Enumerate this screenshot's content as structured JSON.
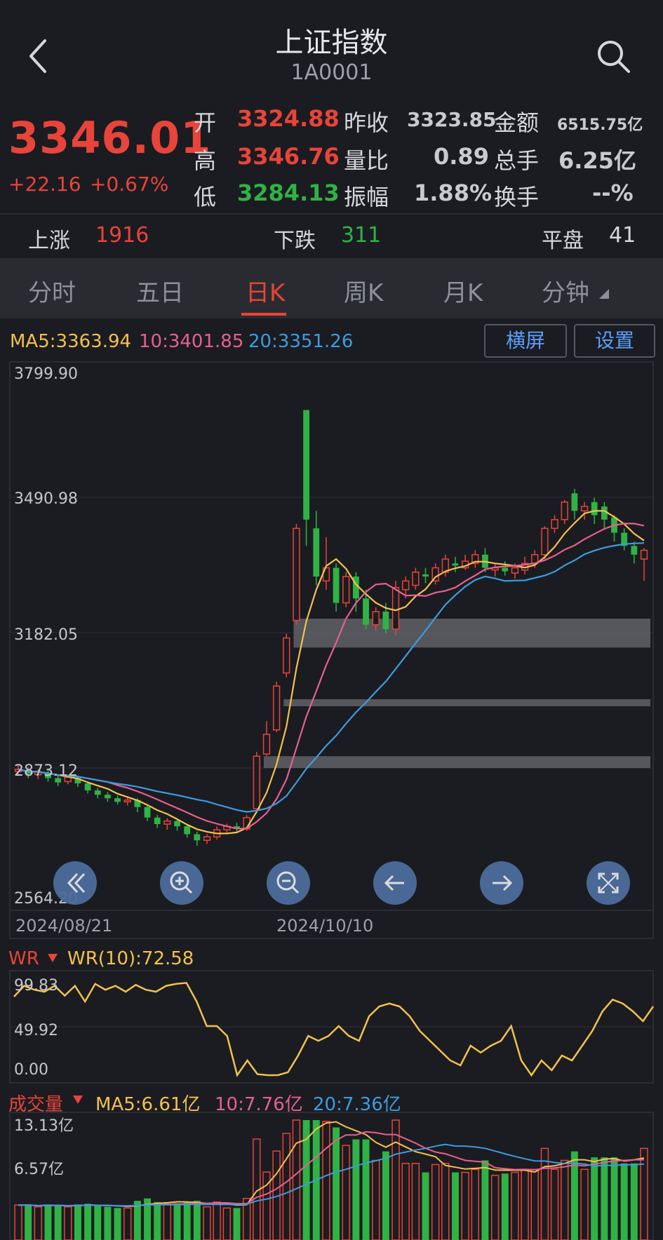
{
  "header": {
    "title": "上证指数",
    "code": "1A0001"
  },
  "quote": {
    "price": "3346.01",
    "change": "+22.16",
    "change_pct": "+0.67%",
    "open_label": "开",
    "open": "3324.88",
    "prev_close_label": "昨收",
    "prev_close": "3323.85",
    "amount_label": "金额",
    "amount": "6515.75亿",
    "high_label": "高",
    "high": "3346.76",
    "vol_ratio_label": "量比",
    "vol_ratio": "0.89",
    "total_vol_label": "总手",
    "total_vol": "6.25亿",
    "low_label": "低",
    "low": "3284.13",
    "amplitude_label": "振幅",
    "amplitude": "1.88%",
    "turnover_label": "换手",
    "turnover": "--%"
  },
  "breadth": {
    "up_label": "上涨",
    "up": "1916",
    "down_label": "下跌",
    "down": "311",
    "flat_label": "平盘",
    "flat": "41"
  },
  "tabs": [
    "分时",
    "五日",
    "日K",
    "周K",
    "月K",
    "分钟"
  ],
  "active_tab": "日K",
  "ma": {
    "ma5": "MA5:3363.94",
    "ma10": "10:3401.85",
    "ma20": "20:3351.26"
  },
  "buttons": {
    "landscape": "横屏",
    "settings": "设置"
  },
  "colors": {
    "red": "#e8443a",
    "green": "#2fb344",
    "ma5": "#f2c14e",
    "ma10": "#e6608f",
    "ma20": "#3d9be0",
    "wr": "#f2c14e"
  },
  "kline_axis": {
    "y_ticks": [
      "3799.90",
      "3490.98",
      "3182.05",
      "2873.12",
      "2564.20"
    ],
    "dates": [
      "2024/08/21",
      "2024/10/10"
    ]
  },
  "nav_icons": [
    "double-left-icon",
    "zoom-in-icon",
    "zoom-out-icon",
    "arrow-left-icon",
    "arrow-right-icon",
    "fullscreen-icon"
  ],
  "wr": {
    "label": "WR",
    "value": "WR(10):72.58",
    "ticks": [
      "99.83",
      "49.92",
      "0.00"
    ]
  },
  "volume": {
    "label": "成交量",
    "ma5": "MA5:6.61亿",
    "ma10": "10:7.76亿",
    "ma20": "20:7.36亿",
    "ticks": [
      "13.13亿",
      "6.57亿"
    ]
  },
  "chart_data": {
    "type": "candlestick",
    "ylim": [
      2564.2,
      3799.9
    ],
    "candles": [
      [
        2865,
        2870,
        2880,
        2855
      ],
      [
        2868,
        2860,
        2875,
        2850
      ],
      [
        2858,
        2864,
        2870,
        2848
      ],
      [
        2862,
        2850,
        2868,
        2842
      ],
      [
        2850,
        2840,
        2856,
        2832
      ],
      [
        2842,
        2852,
        2858,
        2836
      ],
      [
        2850,
        2838,
        2856,
        2830
      ],
      [
        2838,
        2822,
        2842,
        2815
      ],
      [
        2822,
        2812,
        2828,
        2804
      ],
      [
        2812,
        2804,
        2818,
        2796
      ],
      [
        2804,
        2796,
        2810,
        2790
      ],
      [
        2796,
        2800,
        2808,
        2788
      ],
      [
        2800,
        2784,
        2804,
        2772
      ],
      [
        2784,
        2760,
        2788,
        2752
      ],
      [
        2760,
        2745,
        2766,
        2736
      ],
      [
        2745,
        2752,
        2758,
        2732
      ],
      [
        2752,
        2740,
        2758,
        2730
      ],
      [
        2740,
        2722,
        2744,
        2714
      ],
      [
        2722,
        2708,
        2728,
        2696
      ],
      [
        2708,
        2716,
        2722,
        2700
      ],
      [
        2716,
        2732,
        2740,
        2710
      ],
      [
        2732,
        2740,
        2746,
        2726
      ],
      [
        2740,
        2734,
        2748,
        2728
      ],
      [
        2734,
        2760,
        2766,
        2730
      ],
      [
        2780,
        2900,
        2910,
        2775
      ],
      [
        2905,
        2950,
        2980,
        2900
      ],
      [
        2960,
        3060,
        3070,
        2955
      ],
      [
        3090,
        3170,
        3180,
        3080
      ],
      [
        3210,
        3420,
        3430,
        3200
      ],
      [
        3690,
        3440,
        3690,
        3380
      ],
      [
        3420,
        3310,
        3460,
        3290
      ],
      [
        3300,
        3330,
        3400,
        3280
      ],
      [
        3330,
        3250,
        3340,
        3230
      ],
      [
        3250,
        3310,
        3320,
        3240
      ],
      [
        3310,
        3260,
        3320,
        3230
      ],
      [
        3260,
        3200,
        3280,
        3190
      ],
      [
        3200,
        3230,
        3240,
        3185
      ],
      [
        3230,
        3190,
        3250,
        3180
      ],
      [
        3190,
        3285,
        3300,
        3175
      ],
      [
        3280,
        3300,
        3310,
        3260
      ],
      [
        3290,
        3320,
        3330,
        3280
      ],
      [
        3315,
        3310,
        3330,
        3295
      ],
      [
        3300,
        3330,
        3340,
        3292
      ],
      [
        3320,
        3350,
        3360,
        3310
      ],
      [
        3340,
        3335,
        3355,
        3320
      ],
      [
        3330,
        3345,
        3360,
        3325
      ],
      [
        3340,
        3360,
        3370,
        3330
      ],
      [
        3360,
        3330,
        3375,
        3320
      ],
      [
        3325,
        3330,
        3340,
        3310
      ],
      [
        3330,
        3322,
        3345,
        3312
      ],
      [
        3318,
        3330,
        3340,
        3305
      ],
      [
        3325,
        3340,
        3355,
        3315
      ],
      [
        3340,
        3360,
        3370,
        3330
      ],
      [
        3360,
        3420,
        3425,
        3350
      ],
      [
        3420,
        3440,
        3450,
        3410
      ],
      [
        3440,
        3480,
        3485,
        3430
      ],
      [
        3500,
        3460,
        3510,
        3440
      ],
      [
        3460,
        3470,
        3480,
        3440
      ],
      [
        3480,
        3450,
        3490,
        3430
      ],
      [
        3470,
        3440,
        3480,
        3420
      ],
      [
        3445,
        3410,
        3450,
        3390
      ],
      [
        3410,
        3380,
        3420,
        3370
      ],
      [
        3380,
        3360,
        3390,
        3340
      ],
      [
        3350,
        3370,
        3375,
        3300
      ]
    ],
    "zones": [
      [
        3148,
        3214
      ],
      [
        3014,
        3030
      ],
      [
        2873,
        2900
      ]
    ],
    "wr_series": [
      85,
      96,
      92,
      90,
      96,
      86,
      96,
      80,
      98,
      92,
      96,
      90,
      97,
      92,
      90,
      96,
      98,
      99,
      80,
      55,
      55,
      45,
      5,
      20,
      6,
      5,
      5,
      8,
      25,
      45,
      40,
      45,
      55,
      45,
      40,
      65,
      75,
      78,
      75,
      65,
      50,
      40,
      30,
      20,
      15,
      35,
      28,
      35,
      40,
      55,
      20,
      5,
      20,
      10,
      25,
      20,
      35,
      50,
      70,
      82,
      78,
      70,
      60,
      75
    ]
  }
}
